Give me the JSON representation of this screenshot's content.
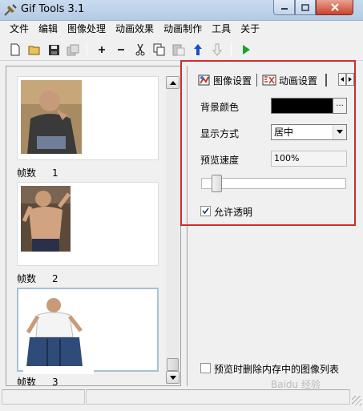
{
  "window": {
    "title": "Gif Tools 3.1",
    "accent": "#d22a2a"
  },
  "menu": [
    "文件",
    "编辑",
    "图像处理",
    "动画效果",
    "动画制作",
    "工具",
    "关于"
  ],
  "toolbar": {
    "icons": [
      "new-file-icon",
      "open-folder-icon",
      "save-icon",
      "copy-frames-icon",
      "add-frame-icon",
      "remove-frame-icon",
      "cut-icon",
      "copy-icon",
      "paste-icon",
      "move-up-icon",
      "move-down-icon",
      "play-icon"
    ]
  },
  "frames": [
    {
      "label": "帧数",
      "number": "1",
      "selected": false
    },
    {
      "label": "帧数",
      "number": "2",
      "selected": false
    },
    {
      "label": "帧数",
      "number": "3",
      "selected": true
    }
  ],
  "tabs": {
    "image_settings": "图像设置",
    "animation_settings": "动画设置"
  },
  "settings": {
    "background_color_label": "背景颜色",
    "background_color_value": "#000000",
    "color_button": "...",
    "display_mode_label": "显示方式",
    "display_mode_value": "居中",
    "preview_speed_label": "预览速度",
    "preview_speed_value": "100%",
    "slider_position": 0.08,
    "allow_transparent_label": "允许透明",
    "allow_transparent_checked": true,
    "delete_list_label": "预览时删除内存中的图像列表",
    "delete_list_checked": false
  },
  "watermark": "Baidu 经验"
}
